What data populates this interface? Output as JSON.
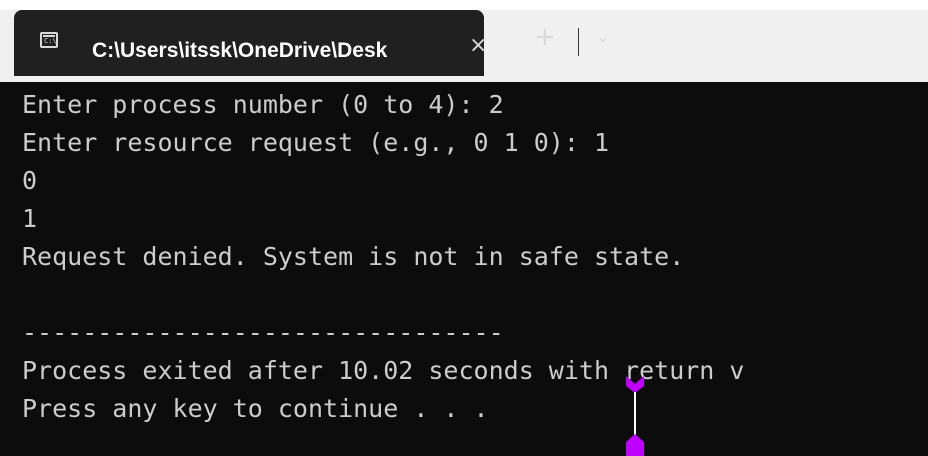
{
  "tab": {
    "title": "C:\\Users\\itssk\\OneDrive\\Desk",
    "close_symbol": "×",
    "icon": "terminal-icon"
  },
  "titlebar": {
    "new_tab_symbol": "+",
    "dropdown_symbol": "⌄"
  },
  "terminal": {
    "lines": [
      "Enter process number (0 to 4): 2",
      "Enter resource request (e.g., 0 1 0): 1",
      "0",
      "1",
      "Request denied. System is not in safe state.",
      "",
      "--------------------------------",
      "Process exited after 10.02 seconds with return v",
      "Press any key to continue . . ."
    ]
  },
  "colors": {
    "tab_background": "#202020",
    "terminal_background": "#0c0c0c",
    "text": "#cccccc",
    "cursor_marker": "#c000ff"
  }
}
